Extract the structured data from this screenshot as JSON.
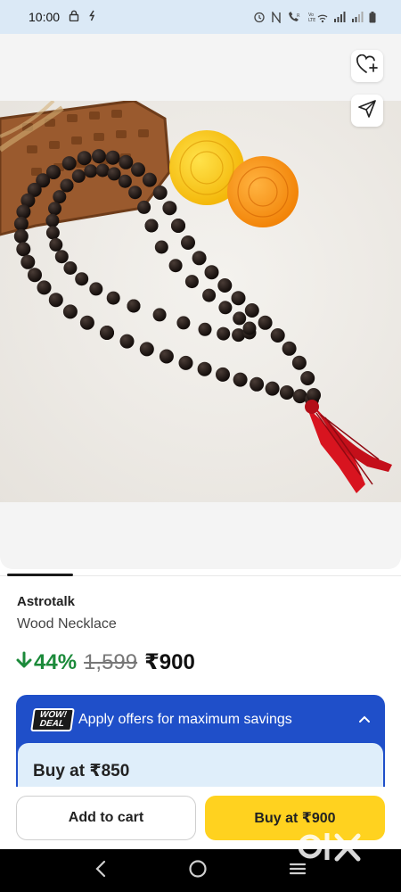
{
  "status_bar": {
    "time": "10:00"
  },
  "product": {
    "brand": "Astrotalk",
    "name": "Wood Necklace",
    "discount": "44%",
    "mrp": "1,599",
    "price": "₹900"
  },
  "offers": {
    "logo_line1": "WOW!",
    "logo_line2": "DEAL",
    "title": "Apply offers for maximum savings",
    "buy_at": "Buy at ₹850"
  },
  "actions": {
    "add_to_cart": "Add to cart",
    "buy_now": "Buy at ₹900"
  },
  "colors": {
    "status_bar": "#dbe9f6",
    "discount_green": "#1b8a3a",
    "offer_blue": "#1f4fc9",
    "offer_body": "#dfeefa",
    "buy_yellow": "#ffd21f"
  },
  "icons": {
    "wishlist": "heart-plus-icon",
    "share": "send-icon",
    "offer_toggle": "chevron-up-icon",
    "back": "back-nav-icon",
    "home": "home-nav-icon",
    "recents": "recents-nav-icon"
  }
}
